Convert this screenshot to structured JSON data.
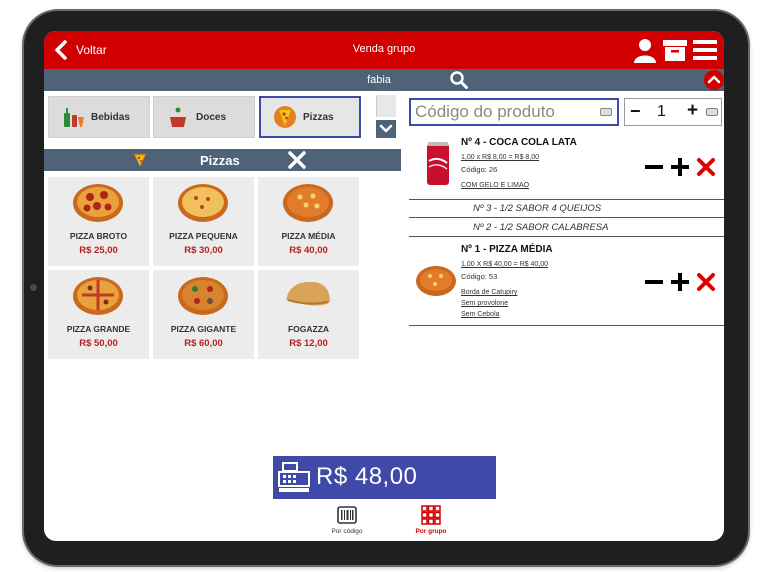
{
  "header": {
    "back_label": "Voltar",
    "title": "Venda grupo",
    "icons": [
      "user-icon",
      "archive-icon",
      "menu-icon"
    ]
  },
  "user_bar": {
    "user": "fabia"
  },
  "categories": [
    {
      "label": "Bebidas",
      "icon": "drinks-icon"
    },
    {
      "label": "Doces",
      "icon": "sweets-icon"
    },
    {
      "label": "Pizzas",
      "icon": "pizza-icon",
      "active": true
    }
  ],
  "group": {
    "title": "Pizzas"
  },
  "products": [
    {
      "name": "PIZZA BROTO",
      "price": "R$ 25,00"
    },
    {
      "name": "PIZZA PEQUENA",
      "price": "R$ 30,00"
    },
    {
      "name": "PIZZA MÉDIA",
      "price": "R$ 40,00"
    },
    {
      "name": "PIZZA GRANDE",
      "price": "R$ 50,00"
    },
    {
      "name": "PIZZA GIGANTE",
      "price": "R$ 60,00"
    },
    {
      "name": "FOGAZZA",
      "price": "R$ 12,00"
    }
  ],
  "entry": {
    "code_placeholder": "Código do produto",
    "quantity": "1",
    "minus": "−",
    "plus": "+"
  },
  "order": {
    "items": [
      {
        "title": "Nº 4 - COCA COLA LATA",
        "line": "1,00 x R$ 8,00 = R$ 8,00",
        "code": "Código: 26",
        "notes": [
          "COM GELO E LIMAO"
        ]
      },
      {
        "title": "Nº 1 - PIZZA MÉDIA",
        "line": "1,00 X R$ 40,00 = R$ 40,00",
        "code": "Código: 53",
        "notes": [
          "Borda de Catupiry",
          "Sem provolone",
          "Sem Cebola"
        ]
      }
    ],
    "halves": [
      "Nº 3 - 1/2 SABOR 4 QUEIJOS",
      "Nº 2 - 1/2 SABOR CALABRESA"
    ]
  },
  "total": {
    "value": "R$  48,00"
  },
  "bottom_nav": [
    {
      "label": "Por código",
      "color": "#333333"
    },
    {
      "label": "Por grupo",
      "color": "#d10000"
    }
  ],
  "colors": {
    "brand_red": "#d10000",
    "slate": "#4f6378",
    "accent_blue": "#3f4aa8",
    "price_red": "#b22222"
  }
}
